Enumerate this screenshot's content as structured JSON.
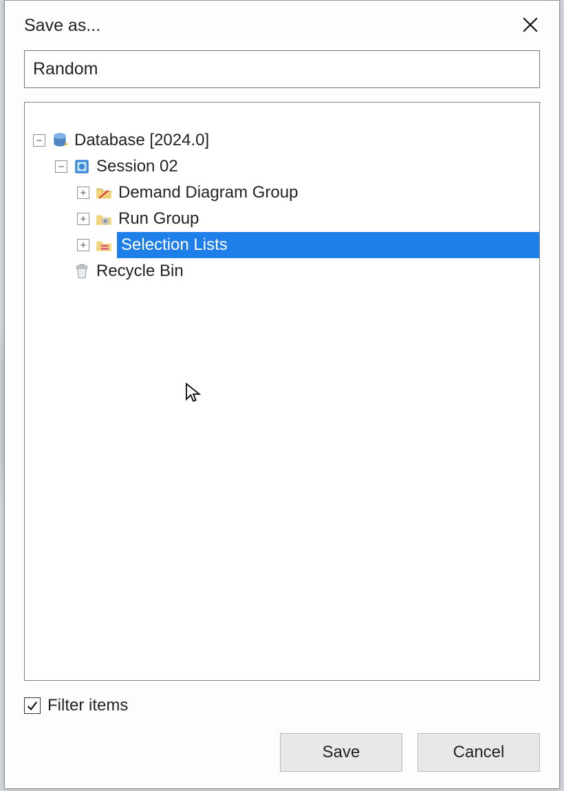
{
  "dialog": {
    "title": "Save as...",
    "name_value": "Random",
    "filter_label": "Filter items",
    "filter_checked": true,
    "save_label": "Save",
    "cancel_label": "Cancel"
  },
  "tree": {
    "root": {
      "label": "Database [2024.0]",
      "expanded": true
    },
    "session": {
      "label": "Session 02",
      "expanded": true
    },
    "children": [
      {
        "label": "Demand Diagram Group",
        "expanded": false,
        "selected": false,
        "icon": "diagram"
      },
      {
        "label": "Run Group",
        "expanded": false,
        "selected": false,
        "icon": "gear"
      },
      {
        "label": "Selection Lists",
        "expanded": false,
        "selected": true,
        "icon": "list"
      }
    ],
    "recycle": {
      "label": "Recycle Bin"
    }
  },
  "colors": {
    "selection": "#1f7fe8",
    "border": "#7e8286",
    "button_bg": "#e8e8e8"
  }
}
